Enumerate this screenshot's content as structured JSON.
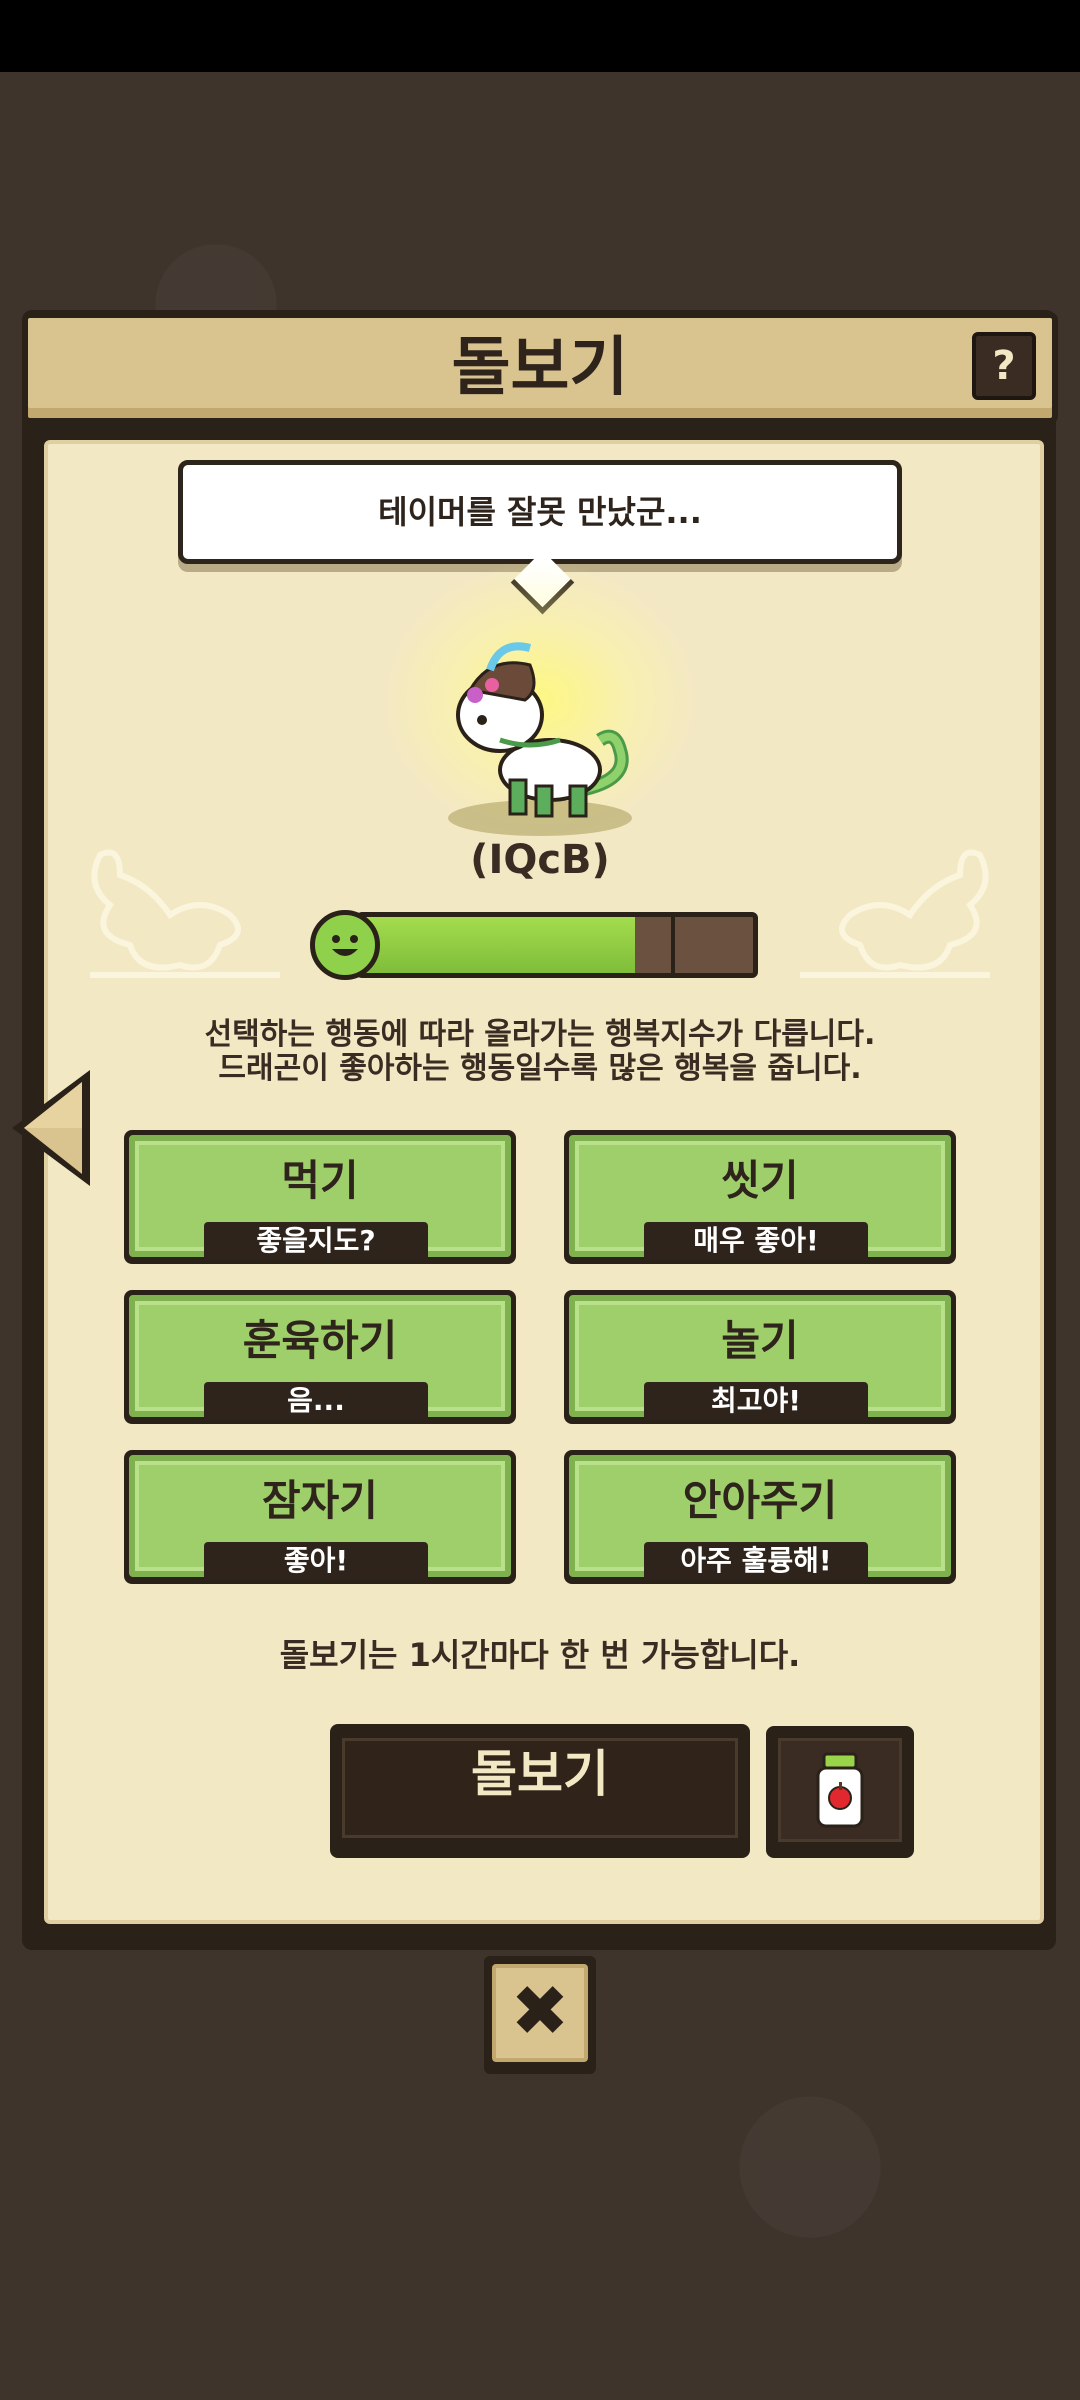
{
  "header": {
    "title": "돌보기",
    "help_label": "?"
  },
  "speech": {
    "text": "테이머를 잘못 만났군..."
  },
  "pet": {
    "name": "(IQcB)",
    "happiness": 0.7
  },
  "description": {
    "line1": "선택하는 행동에 따라 올라가는 행복지수가 다릅니다.",
    "line2": "드래곤이 좋아하는 행동일수록 많은 행복을 줍니다."
  },
  "actions": [
    {
      "label": "먹기",
      "reaction": "좋을지도?"
    },
    {
      "label": "씻기",
      "reaction": "매우 좋아!"
    },
    {
      "label": "훈육하기",
      "reaction": "음..."
    },
    {
      "label": "놀기",
      "reaction": "최고야!"
    },
    {
      "label": "잠자기",
      "reaction": "좋아!"
    },
    {
      "label": "안아주기",
      "reaction": "아주 훌륭해!"
    }
  ],
  "info_text": "돌보기는 1시간마다 한 번 가능합니다.",
  "care_button_label": "돌보기",
  "close_label": "✖",
  "colors": {
    "panel_bg": "#f3e8c4",
    "action_green": "#9ecf6b",
    "happiness_green": "#8fd14a",
    "dark_frame": "#2a2119"
  }
}
